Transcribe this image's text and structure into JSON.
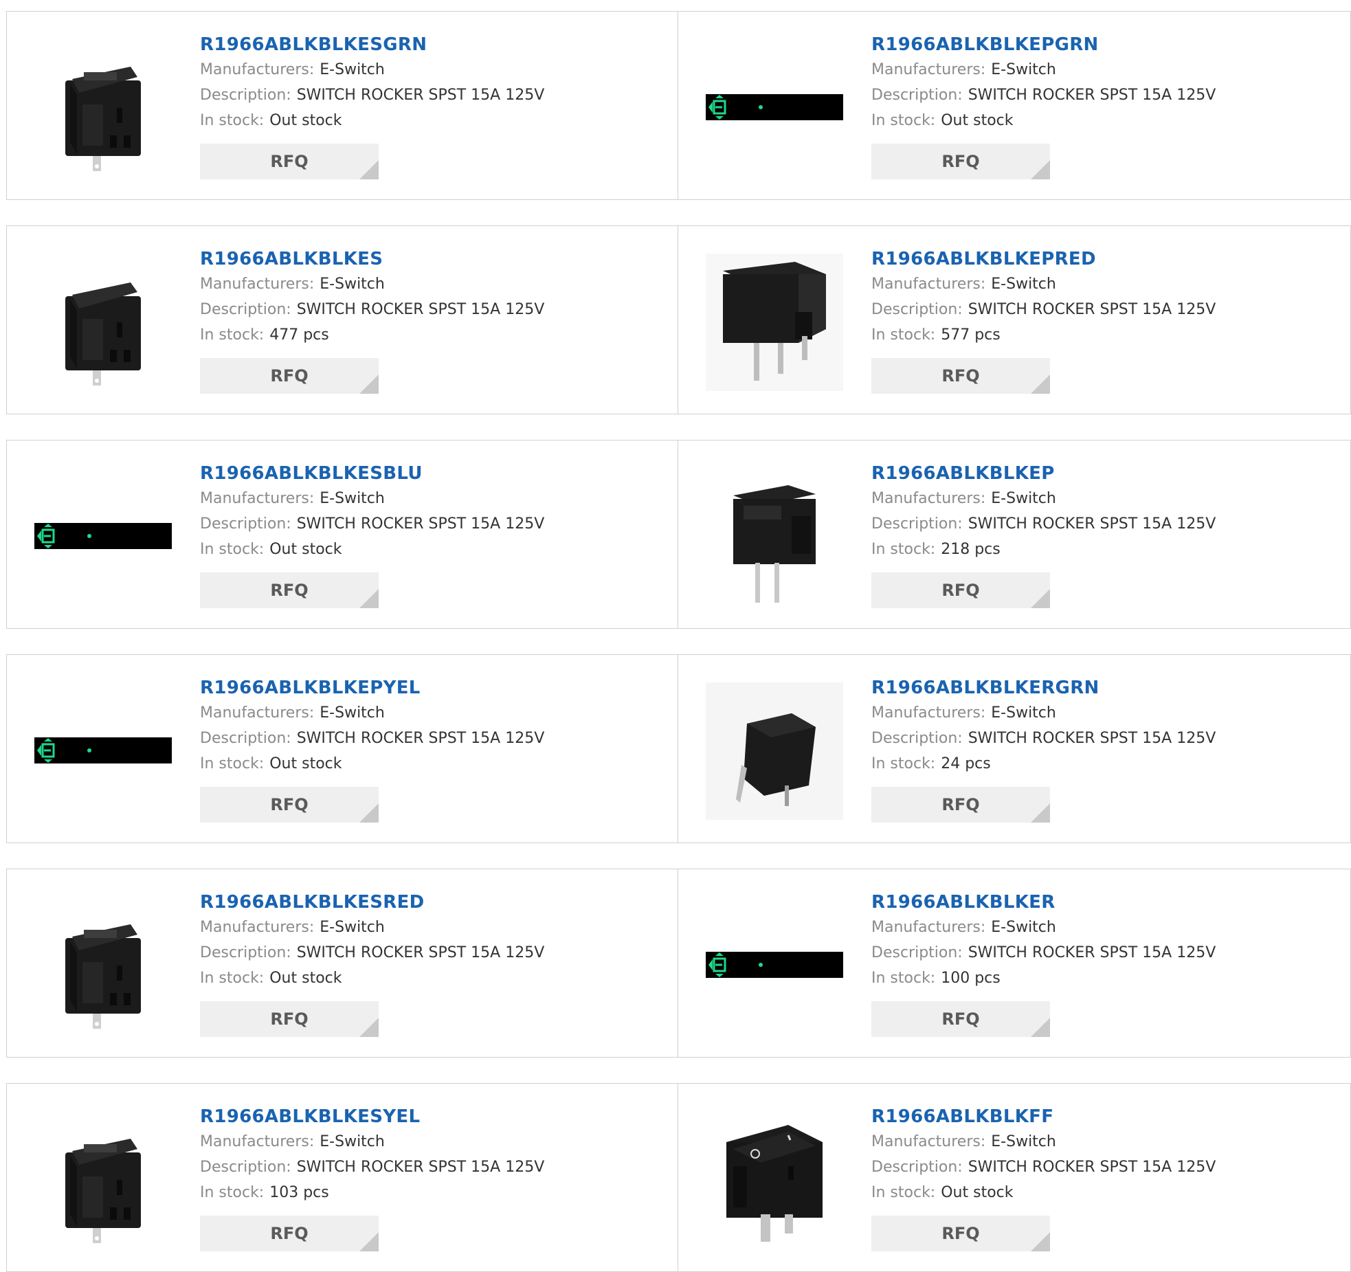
{
  "labels": {
    "manufacturers": "Manufacturers:",
    "description": "Description:",
    "in_stock": "In stock:",
    "rfq": "RFQ"
  },
  "products": [
    {
      "part": "R1966ABLKBLKESGRN",
      "manufacturer": "E-Switch",
      "description": "SWITCH ROCKER SPST 15A 125V",
      "stock": "Out stock",
      "image": "rocker-switch-lit-icon"
    },
    {
      "part": "R1966ABLKBLKEPGRN",
      "manufacturer": "E-Switch",
      "description": "SWITCH ROCKER SPST 15A 125V",
      "stock": "Out stock",
      "image": "placeholder-banner-icon"
    },
    {
      "part": "R1966ABLKBLKES",
      "manufacturer": "E-Switch",
      "description": "SWITCH ROCKER SPST 15A 125V",
      "stock": "477 pcs",
      "image": "rocker-switch-icon"
    },
    {
      "part": "R1966ABLKBLKEPRED",
      "manufacturer": "E-Switch",
      "description": "SWITCH ROCKER SPST 15A 125V",
      "stock": "577 pcs",
      "image": "rocker-switch-pcb-icon"
    },
    {
      "part": "R1966ABLKBLKESBLU",
      "manufacturer": "E-Switch",
      "description": "SWITCH ROCKER SPST 15A 125V",
      "stock": "Out stock",
      "image": "placeholder-banner-icon"
    },
    {
      "part": "R1966ABLKBLKEP",
      "manufacturer": "E-Switch",
      "description": "SWITCH ROCKER SPST 15A 125V",
      "stock": "218 pcs",
      "image": "rocker-switch-pins-icon"
    },
    {
      "part": "R1966ABLKBLKEPYEL",
      "manufacturer": "E-Switch",
      "description": "SWITCH ROCKER SPST 15A 125V",
      "stock": "Out stock",
      "image": "placeholder-banner-icon"
    },
    {
      "part": "R1966ABLKBLKERGRN",
      "manufacturer": "E-Switch",
      "description": "SWITCH ROCKER SPST 15A 125V",
      "stock": "24 pcs",
      "image": "rocker-switch-angled-icon"
    },
    {
      "part": "R1966ABLKBLKESRED",
      "manufacturer": "E-Switch",
      "description": "SWITCH ROCKER SPST 15A 125V",
      "stock": "Out stock",
      "image": "rocker-switch-lit-icon"
    },
    {
      "part": "R1966ABLKBLKER",
      "manufacturer": "E-Switch",
      "description": "SWITCH ROCKER SPST 15A 125V",
      "stock": "100 pcs",
      "image": "placeholder-banner-icon"
    },
    {
      "part": "R1966ABLKBLKESYEL",
      "manufacturer": "E-Switch",
      "description": "SWITCH ROCKER SPST 15A 125V",
      "stock": "103 pcs",
      "image": "rocker-switch-lit-icon"
    },
    {
      "part": "R1966ABLKBLKFF",
      "manufacturer": "E-Switch",
      "description": "SWITCH ROCKER SPST 15A 125V",
      "stock": "Out stock",
      "image": "rocker-switch-marked-icon"
    }
  ],
  "colors": {
    "link": "#1a63b0",
    "label": "#8a8a8a",
    "value": "#333333",
    "button_bg": "#efefef",
    "placeholder_accent": "#1ed98a"
  }
}
